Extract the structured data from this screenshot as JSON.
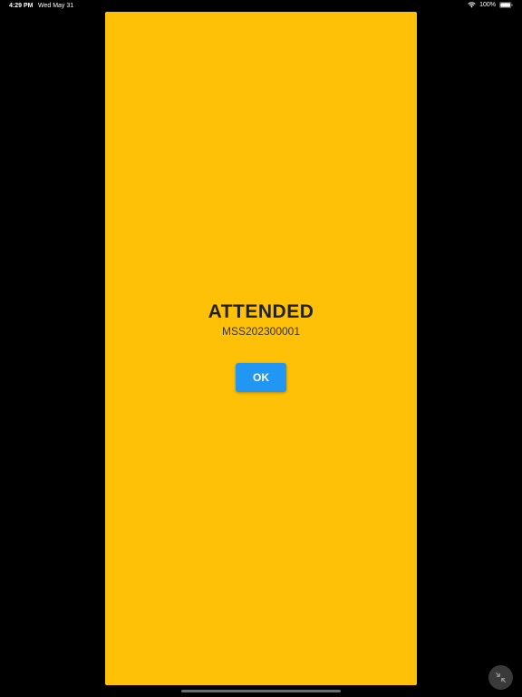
{
  "status_bar": {
    "time": "4:29 PM",
    "date": "Wed May 31",
    "battery_percent": "100%",
    "icons": [
      "wifi-icon",
      "battery-icon"
    ]
  },
  "dialog": {
    "background_color": "#FFC107",
    "status_title": "ATTENDED",
    "student_id": "MSS202300001",
    "ok_label": "OK",
    "ok_button_color": "#2196F3"
  },
  "overlay": {
    "shrink_icon": "shrink-icon"
  }
}
